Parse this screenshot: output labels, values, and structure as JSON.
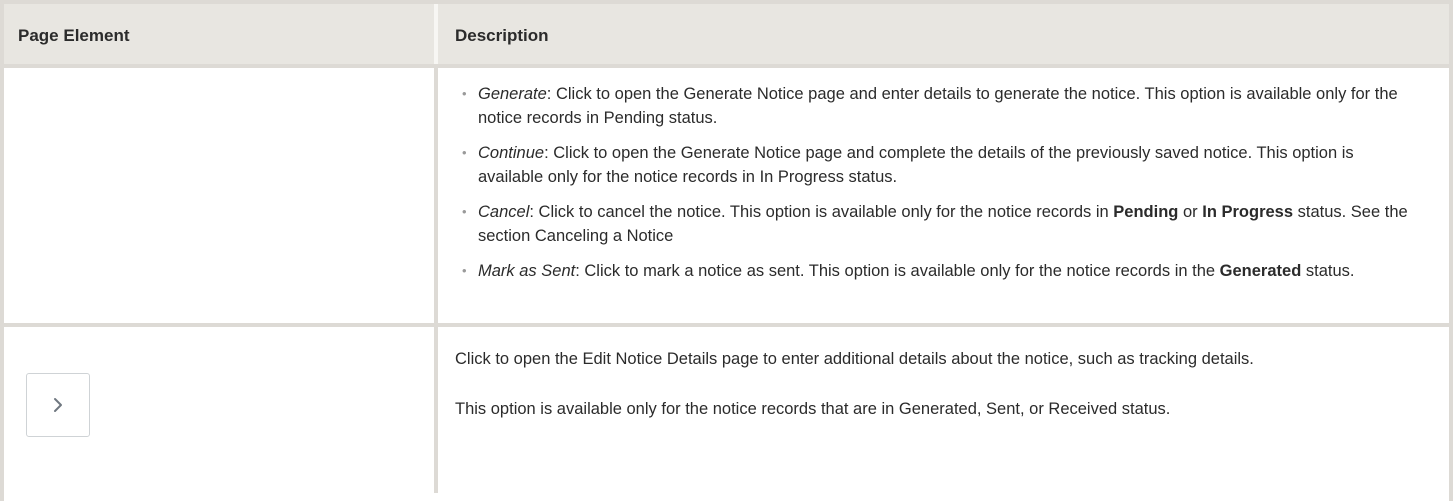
{
  "table": {
    "headers": {
      "page_element": "Page Element",
      "description": "Description"
    },
    "row1": {
      "options": [
        {
          "name": "Generate",
          "text": ": Click to open the Generate Notice page and enter details to generate the notice. This option is available only for the notice records in Pending status."
        },
        {
          "name": "Continue",
          "text": ": Click to open the Generate Notice page and complete the details of the previously saved notice. This option is available only for the notice records in In Progress status."
        },
        {
          "name": "Cancel",
          "text_a": ": Click to cancel the notice. This option is available only for the notice records in ",
          "bold_a": "Pending",
          "text_b": " or ",
          "bold_b": "In Progress",
          "text_c": " status. See the section Canceling a Notice"
        },
        {
          "name": "Mark as Sent",
          "text_a": ": Click to mark a notice as sent. This option is available only for the notice records in the ",
          "bold_a": "Generated",
          "text_b": " status."
        }
      ]
    },
    "row2": {
      "icon": "chevron-right-icon",
      "icon_color": "#6f7780",
      "paragraph1": "Click to open the Edit Notice Details page to enter additional details about the notice, such as tracking details.",
      "paragraph2": "This option is available only for the notice records that are in Generated, Sent, or Received status."
    }
  }
}
